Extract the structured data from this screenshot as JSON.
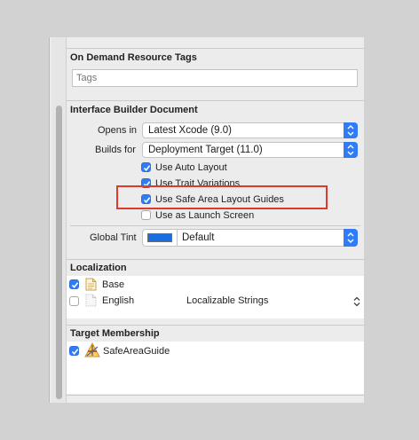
{
  "on_demand": {
    "title": "On Demand Resource Tags",
    "tags_placeholder": "Tags"
  },
  "ib_document": {
    "title": "Interface Builder Document",
    "opens_in_label": "Opens in",
    "opens_in_value": "Latest Xcode (9.0)",
    "builds_for_label": "Builds for",
    "builds_for_value": "Deployment Target (11.0)",
    "options": [
      {
        "label": "Use Auto Layout",
        "checked": true
      },
      {
        "label": "Use Trait Variations",
        "checked": true
      },
      {
        "label": "Use Safe Area Layout Guides",
        "checked": true,
        "highlighted": true
      },
      {
        "label": "Use as Launch Screen",
        "checked": false
      }
    ],
    "global_tint_label": "Global Tint",
    "global_tint_value": "Default",
    "global_tint_color": "#1a6fe0"
  },
  "localization": {
    "title": "Localization",
    "items": [
      {
        "checked": true,
        "name": "Base",
        "type": "",
        "icon": "file-icon"
      },
      {
        "checked": false,
        "name": "English",
        "type": "Localizable Strings",
        "icon": "file-icon"
      }
    ]
  },
  "target_membership": {
    "title": "Target Membership",
    "items": [
      {
        "checked": true,
        "name": "SafeAreaGuide",
        "icon": "app-target-icon"
      }
    ]
  },
  "colors": {
    "accent": "#2f7cf6",
    "highlight_box": "#e0392b"
  }
}
